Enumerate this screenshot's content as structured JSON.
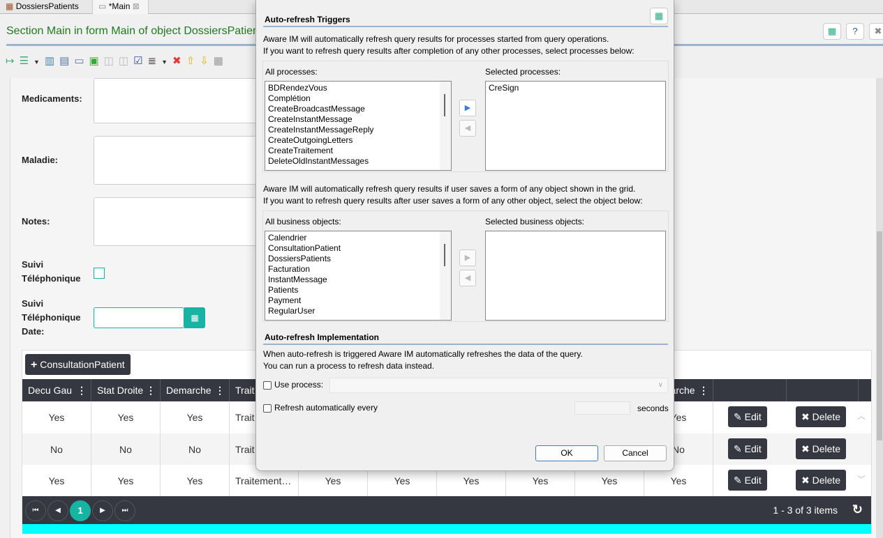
{
  "tabs": [
    {
      "label": "DossiersPatients"
    },
    {
      "label": "*Main"
    }
  ],
  "header": {
    "title": "Section Main in form Main of object DossiersPatients"
  },
  "form": {
    "labels": {
      "medicaments": "Medicaments:",
      "maladie": "Maladie:",
      "notes": "Notes:",
      "suivi1": "Suivi",
      "suivi2": "Téléphonique",
      "sdate1": "Suivi",
      "sdate2": "Téléphonique",
      "sdate3": "Date:"
    }
  },
  "grid": {
    "add_button": "ConsultationPatient",
    "columns": [
      "Decu Gau",
      "Stat Droite",
      "Demarche",
      "Trait",
      "",
      "",
      "",
      "",
      "",
      "Demarche"
    ],
    "rows": [
      [
        "Yes",
        "Yes",
        "Yes",
        "Trait",
        "",
        "",
        "",
        "",
        "",
        "Yes"
      ],
      [
        "No",
        "No",
        "No",
        "Trait",
        "",
        "",
        "",
        "",
        "",
        "No"
      ],
      [
        "Yes",
        "Yes",
        "Yes",
        "Traitement…",
        "Yes",
        "Yes",
        "Yes",
        "Yes",
        "Yes",
        "Yes"
      ]
    ],
    "edit_label": "Edit",
    "delete_label": "Delete",
    "current_page": "1",
    "items_text": "1 - 3 of 3 items"
  },
  "dialog": {
    "triggers_title": "Auto-refresh Triggers",
    "proc_text1": "Aware IM will automatically refresh query results for processes started from query operations.",
    "proc_text2": "If you want to refresh query results after completion of any other processes, select processes below:",
    "all_processes_label": "All processes:",
    "selected_processes_label": "Selected processes:",
    "all_processes": [
      "BDRendezVous",
      "Complétion",
      "CreateBroadcastMessage",
      "CreateInstantMessage",
      "CreateInstantMessageReply",
      "CreateOutgoingLetters",
      "CreateTraitement",
      "DeleteOldInstantMessages"
    ],
    "selected_processes": [
      "CreSign"
    ],
    "obj_text1": "Aware IM will automatically refresh query results if user saves a form of any object shown in the grid.",
    "obj_text2": "If you want to refresh query results after user saves a form of any other object, select the object below:",
    "all_objects_label": "All business objects:",
    "selected_objects_label": "Selected business objects:",
    "all_objects": [
      "Calendrier",
      "ConsultationPatient",
      "DossiersPatients",
      "Facturation",
      "InstantMessage",
      "Patients",
      "Payment",
      "RegularUser"
    ],
    "impl_title": "Auto-refresh Implementation",
    "impl_text1": "When auto-refresh is triggered Aware IM automatically refreshes the data of the query.",
    "impl_text2": "You can run a process to refresh data instead.",
    "use_process_label": "Use process:",
    "use_process_value": "",
    "refresh_label": "Refresh automatically every",
    "refresh_value": "",
    "seconds_label": "seconds",
    "ok_label": "OK",
    "cancel_label": "Cancel"
  },
  "colors": {
    "title_green": "#1e7b1e",
    "teal": "#17b3a3",
    "dark": "#353840",
    "cyan": "#00ffff"
  }
}
